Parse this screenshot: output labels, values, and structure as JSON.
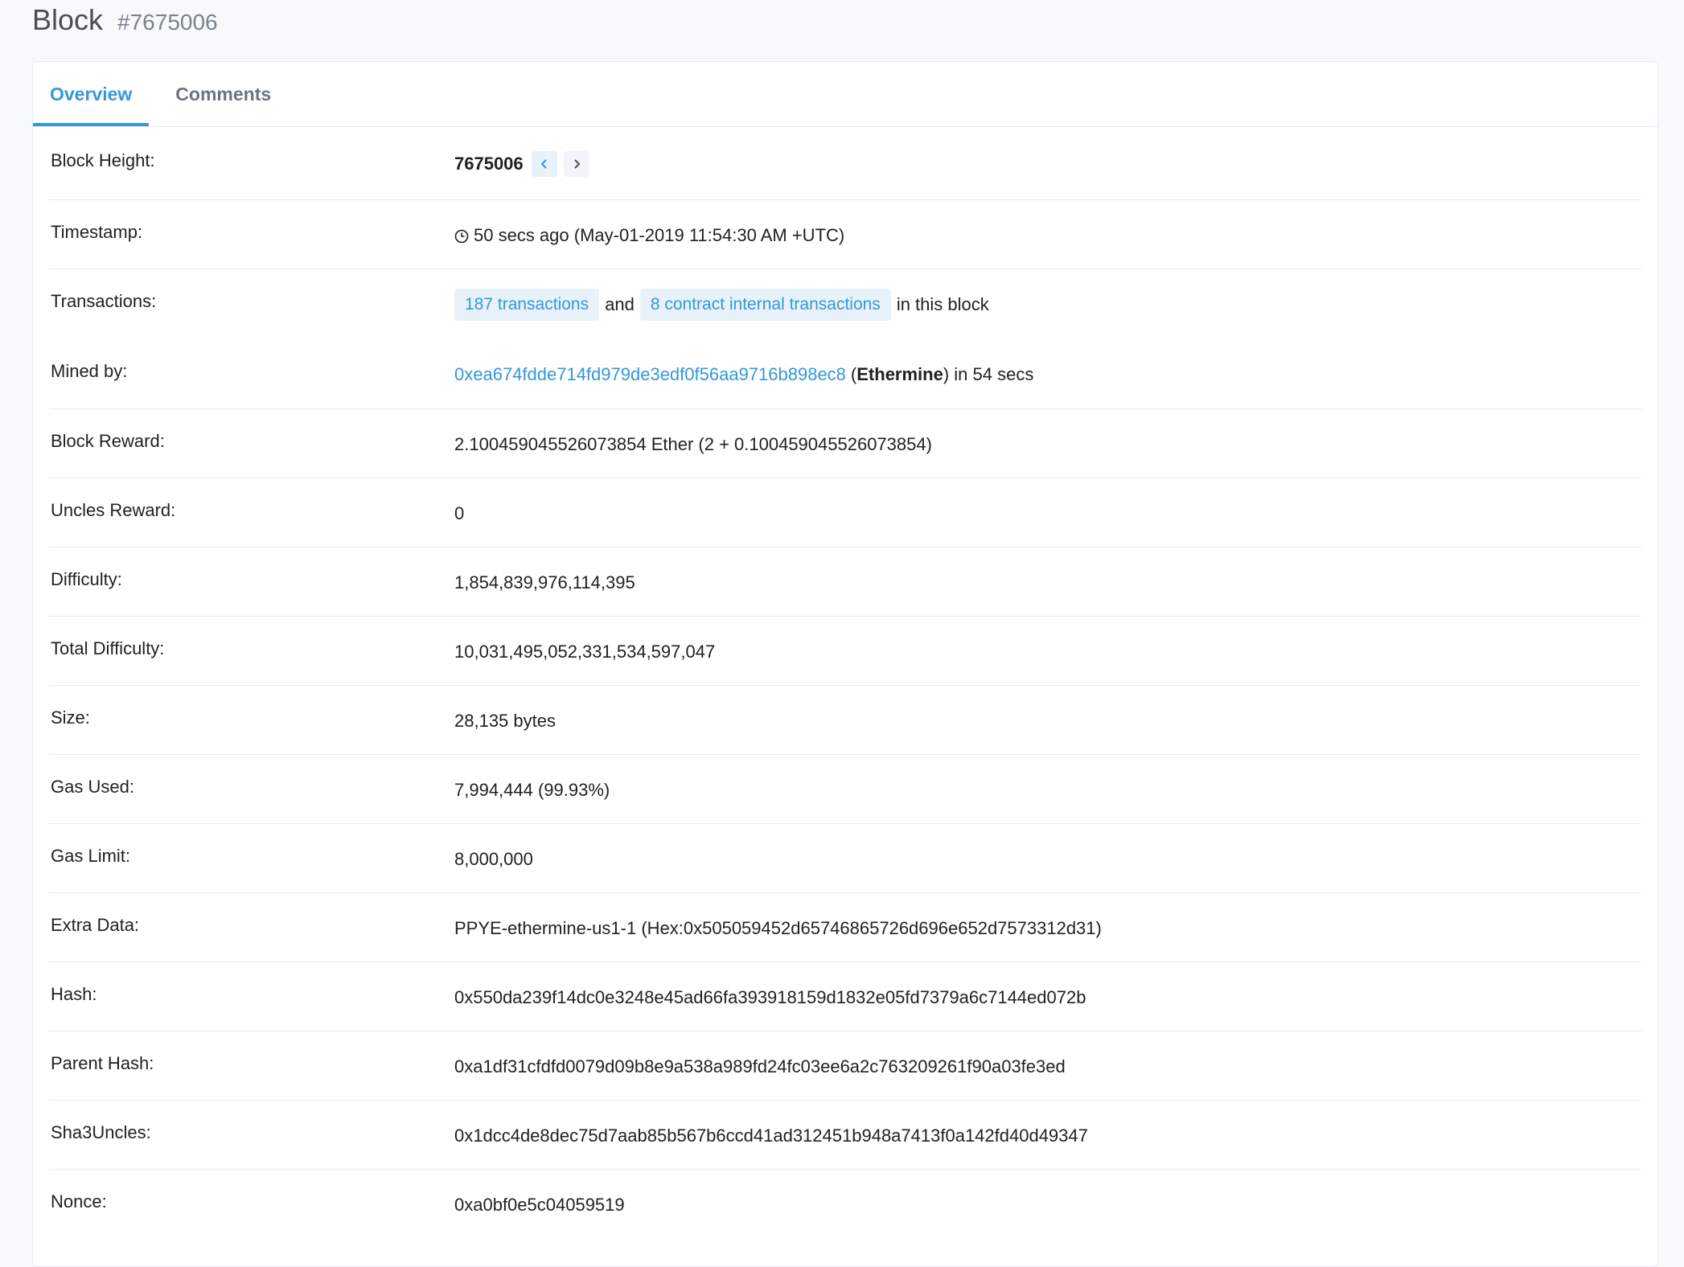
{
  "header": {
    "title": "Block",
    "subtitle": "#7675006"
  },
  "tabs": [
    {
      "label": "Overview",
      "active": true
    },
    {
      "label": "Comments",
      "active": false
    }
  ],
  "rows": {
    "block_height": {
      "label": "Block Height:",
      "value": "7675006"
    },
    "timestamp": {
      "label": "Timestamp:",
      "value": "50 secs ago (May-01-2019 11:54:30 AM +UTC)",
      "icon": "clock-icon"
    },
    "transactions": {
      "label": "Transactions:",
      "tx_link": "187 transactions",
      "and": "and",
      "internal_link": "8 contract internal transactions",
      "suffix": "in this block"
    },
    "mined_by": {
      "label": "Mined by:",
      "address": "0xea674fdde714fd979de3edf0f56aa9716b898ec8",
      "open_paren": "(",
      "miner": "Ethermine",
      "suffix": ") in 54 secs"
    },
    "block_reward": {
      "label": "Block Reward:",
      "value": "2.100459045526073854 Ether (2 + 0.100459045526073854)"
    },
    "uncles_reward": {
      "label": "Uncles Reward:",
      "value": "0"
    },
    "difficulty": {
      "label": "Difficulty:",
      "value": "1,854,839,976,114,395"
    },
    "total_difficulty": {
      "label": "Total Difficulty:",
      "value": "10,031,495,052,331,534,597,047"
    },
    "size": {
      "label": "Size:",
      "value": "28,135 bytes"
    },
    "gas_used": {
      "label": "Gas Used:",
      "value": "7,994,444 (99.93%)"
    },
    "gas_limit": {
      "label": "Gas Limit:",
      "value": "8,000,000"
    },
    "extra_data": {
      "label": "Extra Data:",
      "value": "PPYE-ethermine-us1-1 (Hex:0x505059452d65746865726d696e652d7573312d31)"
    },
    "hash": {
      "label": "Hash:",
      "value": "0x550da239f14dc0e3248e45ad66fa393918159d1832e05fd7379a6c7144ed072b"
    },
    "parent_hash": {
      "label": "Parent Hash:",
      "value": "0xa1df31cfdfd0079d09b8e9a538a989fd24fc03ee6a2c763209261f90a03fe3ed"
    },
    "sha3uncles": {
      "label": "Sha3Uncles:",
      "value": "0x1dcc4de8dec75d7aab85b567b6ccd41ad312451b948a7413f0a142fd40d49347"
    },
    "nonce": {
      "label": "Nonce:",
      "value": "0xa0bf0e5c04059519"
    }
  },
  "colors": {
    "accent": "#3498db",
    "pill_bg": "#e8f2fb",
    "border": "#e7eaf3",
    "page_bg": "#f8f9fa"
  }
}
